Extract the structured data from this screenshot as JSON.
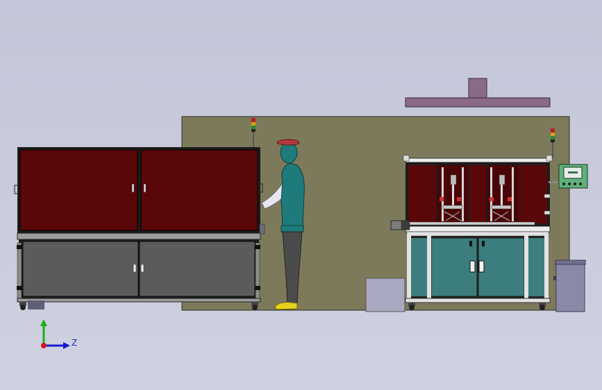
{
  "viewport": {
    "background_top": "#c3c6d8",
    "background_bottom": "#cfd1e0"
  },
  "scene": {
    "colors": {
      "back_wall": "#7d7a5c",
      "enclosure_red": "#5a0709",
      "frame_dark": "#1c1c1c",
      "cabinet_gray": "#5b5b5b",
      "cabinet_teal": "#3c7d7d",
      "body_teal": "#1f7b7b",
      "legs_gray": "#4b4b4b",
      "shoes_yellow": "#e6d21c",
      "hat_red": "#b23a3a",
      "overhead_purple": "#8a6b86",
      "box_lavender": "#a8a8c0",
      "bin_gray": "#8a8aa8",
      "hmi_green": "#5fb07a"
    }
  },
  "triad": {
    "z_label": "Z",
    "colors": {
      "x": "#d01818",
      "y": "#18b018",
      "z": "#1818d0"
    }
  }
}
